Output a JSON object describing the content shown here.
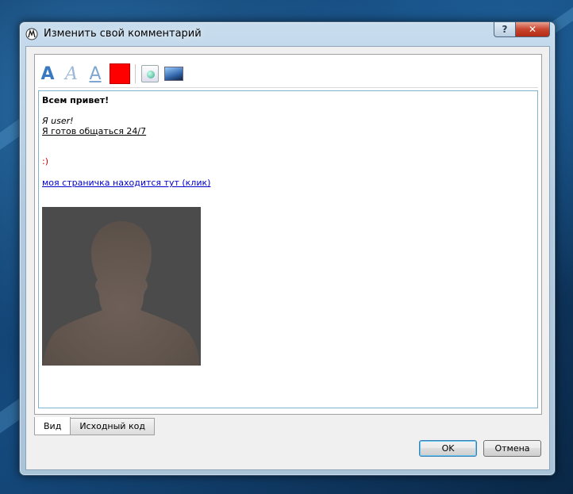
{
  "window": {
    "title": "Изменить свой комментарий",
    "help_label": "?",
    "close_label": "✕"
  },
  "toolbar": {
    "bold_label": "A",
    "italic_label": "A",
    "underline_label": "A",
    "text_color": "#ff0000"
  },
  "editor": {
    "greeting": "Всем привет!",
    "line1": "Я user!",
    "line2": "Я готов общаться 24/7",
    "smile": ":)",
    "link_text": "моя страничка находится тут (клик)"
  },
  "tabs": [
    {
      "label": "Вид",
      "active": true
    },
    {
      "label": "Исходный код",
      "active": false
    }
  ],
  "buttons": {
    "ok": "OK",
    "cancel": "Отмена"
  }
}
